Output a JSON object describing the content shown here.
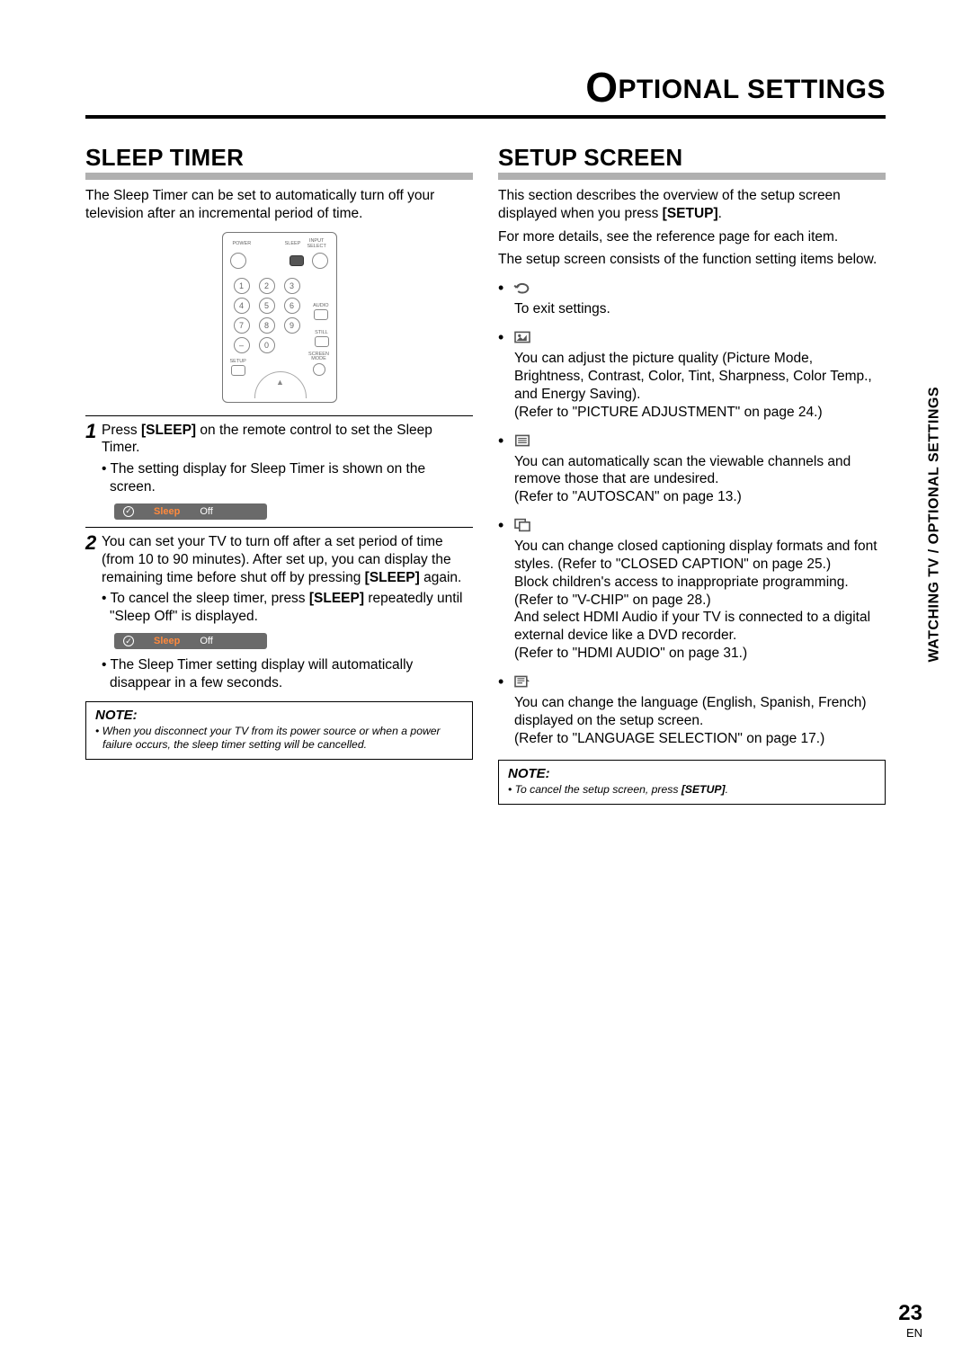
{
  "chapter": {
    "title_rest": "PTIONAL SETTINGS"
  },
  "side_tab": "WATCHING TV / OPTIONAL SETTINGS",
  "page_number": "23",
  "page_lang": "EN",
  "left": {
    "heading": "SLEEP TIMER",
    "intro": "The Sleep Timer can be set to automatically turn off your television after an incremental period of time.",
    "remote": {
      "labels": {
        "power": "POWER",
        "sleep": "SLEEP",
        "input": "INPUT SELECT",
        "audio": "AUDIO",
        "still": "STILL",
        "setup": "SETUP",
        "screen": "SCREEN MODE"
      },
      "nums": [
        "1",
        "2",
        "3",
        "4",
        "5",
        "6",
        "7",
        "8",
        "9",
        "–",
        "0"
      ]
    },
    "step1": {
      "line1_a": "Press ",
      "line1_b": "[SLEEP]",
      "line1_c": " on the remote control to set the Sleep Timer.",
      "bullet": "The setting display for Sleep Timer is shown on the screen."
    },
    "osd1": {
      "label": "Sleep",
      "value": "Off"
    },
    "step2": {
      "line_a": "You can set your TV to turn off after a set period of time (from 10 to 90 minutes). After set up, you can display the remaining time before shut off by pressing ",
      "line_b": "[SLEEP]",
      "line_c": " again.",
      "bullet1_a": "To cancel the sleep timer, press ",
      "bullet1_b": "[SLEEP]",
      "bullet1_c": " repeatedly until \"Sleep Off\" is displayed.",
      "bullet2": "The Sleep Timer setting display will automatically disappear in a few seconds."
    },
    "osd2": {
      "label": "Sleep",
      "value": "Off"
    },
    "note": {
      "title": "NOTE:",
      "body": "When you disconnect your TV from its power source or when a power failure occurs, the sleep timer setting will be cancelled."
    }
  },
  "right": {
    "heading": "SETUP SCREEN",
    "p1_a": "This section describes the overview of the setup screen displayed when you press ",
    "p1_b": "[SETUP]",
    "p1_c": ".",
    "p2": "For more details, see the reference page for each item.",
    "p3": "The setup screen consists of the function setting items below.",
    "items": [
      {
        "icon": "exit",
        "desc": "To exit settings."
      },
      {
        "icon": "picture",
        "desc": "You can adjust the picture quality (Picture Mode, Brightness, Contrast, Color, Tint, Sharpness, Color Temp., and Energy Saving).\n(Refer to \"PICTURE ADJUSTMENT\" on page 24.)"
      },
      {
        "icon": "channel",
        "desc": "You can automatically scan the viewable channels and remove those that are undesired.\n(Refer to \"AUTOSCAN\" on page 13.)"
      },
      {
        "icon": "caption",
        "desc": "You can change closed captioning display formats and font styles. (Refer to \"CLOSED CAPTION\" on page 25.)\nBlock children's access to inappropriate programming. (Refer to \"V-CHIP\" on page 28.)\nAnd select HDMI Audio if your TV is connected to a digital external device like a DVD recorder.\n(Refer to \"HDMI AUDIO\" on page 31.)"
      },
      {
        "icon": "lang",
        "desc": "You can change the language (English, Spanish, French) displayed on the setup screen.\n(Refer to \"LANGUAGE SELECTION\" on page 17.)"
      }
    ],
    "note": {
      "title": "NOTE:",
      "body_a": "To cancel the setup screen, press ",
      "body_b": "[SETUP]",
      "body_c": "."
    }
  }
}
